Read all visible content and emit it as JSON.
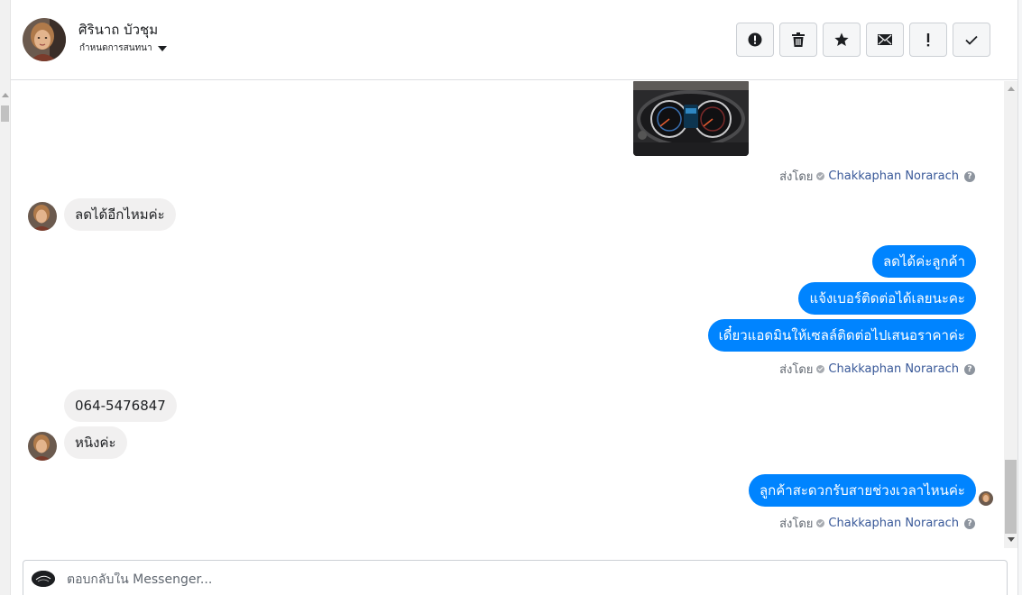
{
  "header": {
    "contact_name": "ศิรินาถ บัวชุม",
    "subtitle": "กำหนดการสนทนา",
    "avatar_icon": "person-avatar",
    "toolbar": [
      {
        "icon": "alert-circle-icon",
        "name": "mark-spam-button"
      },
      {
        "icon": "trash-icon",
        "name": "delete-button"
      },
      {
        "icon": "star-icon",
        "name": "star-button"
      },
      {
        "icon": "envelope-icon",
        "name": "mark-unread-button"
      },
      {
        "icon": "exclamation-icon",
        "name": "follow-up-button"
      },
      {
        "icon": "check-icon",
        "name": "mark-done-button"
      }
    ]
  },
  "messages": {
    "photo_icon": "car-dashboard-photo",
    "sent_label": "ส่งโดย",
    "sender_name": "Chakkaphan Norarach",
    "incoming_1": "ลดได้อีกไหมค่ะ",
    "outgoing_1": "ลดได้ค่ะลูกค้า",
    "outgoing_2": "แจ้งเบอร์ติดต่อได้เลยนะคะ",
    "outgoing_3": "เดี๋ยวแอดมินให้เซลล์ติดต่อไปเสนอราคาค่ะ",
    "incoming_2": "064-5476847",
    "incoming_3": "หนิงค่ะ",
    "outgoing_4": "ลูกค้าสะดวกรับสายช่วงเวลาไหนค่ะ"
  },
  "composer": {
    "placeholder": "ตอบกลับใน Messenger..."
  },
  "colors": {
    "outgoing_bubble": "#0084ff",
    "incoming_bubble": "#f1f0f0",
    "link": "#385898"
  }
}
